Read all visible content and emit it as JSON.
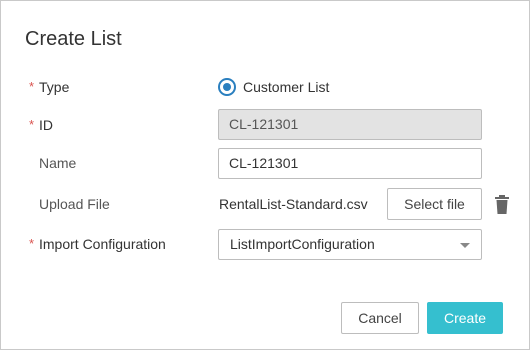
{
  "dialog": {
    "title": "Create List"
  },
  "form": {
    "required_marker": "*",
    "type": {
      "label": "Type",
      "option_label": "Customer List",
      "selected": true
    },
    "id": {
      "label": "ID",
      "value": "CL-121301"
    },
    "name": {
      "label": "Name",
      "value": "CL-121301"
    },
    "upload": {
      "label": "Upload File",
      "file_name": "RentalList-Standard.csv",
      "select_button": "Select file",
      "delete_icon": "trash-icon"
    },
    "import_config": {
      "label": "Import Configuration",
      "selected_value": "ListImportConfiguration",
      "dropdown_icon": "caret-down-icon"
    }
  },
  "footer": {
    "cancel_label": "Cancel",
    "create_label": "Create"
  },
  "colors": {
    "required_star": "#d9534f",
    "radio_accent": "#2a7fbf",
    "primary_button": "#35bfcf",
    "disabled_input_bg": "#e3e3e3"
  }
}
